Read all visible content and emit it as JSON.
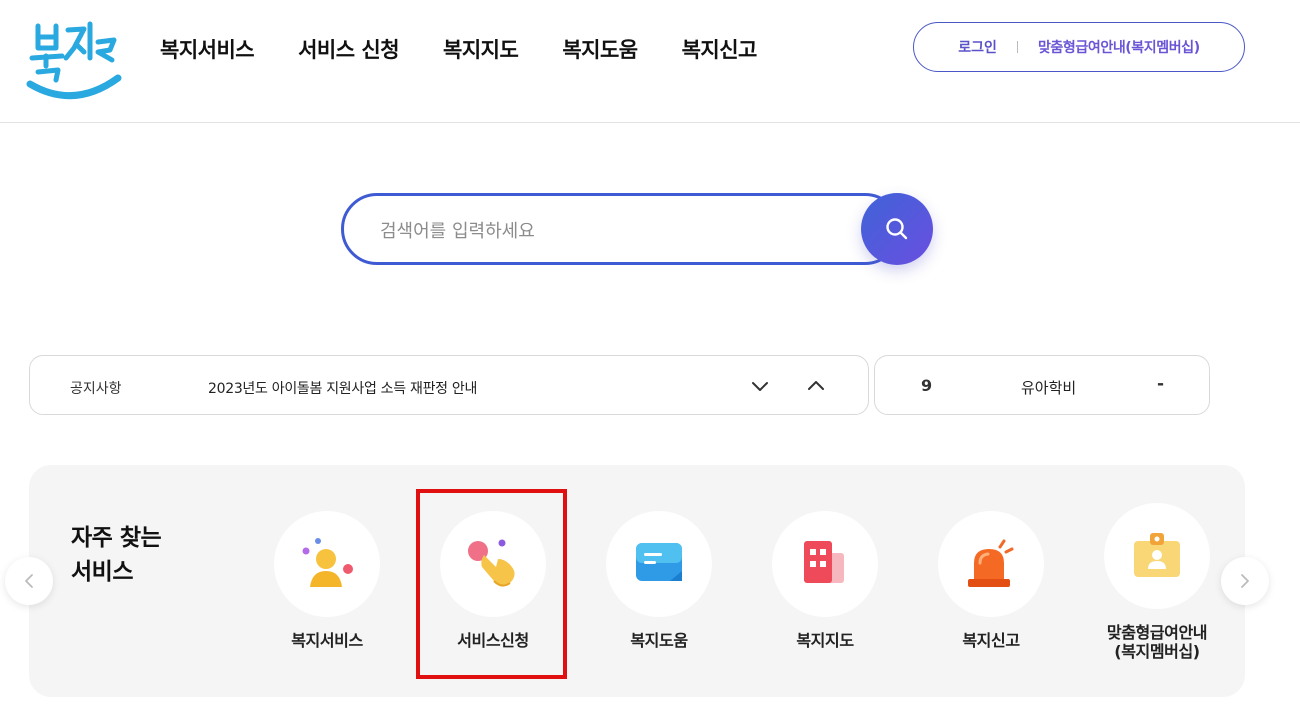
{
  "header": {
    "logo_text": "복지로",
    "nav": [
      "복지서비스",
      "서비스 신청",
      "복지지도",
      "복지도움",
      "복지신고"
    ],
    "login_label": "로그인",
    "custom_label": "맞춤형급여안내(복지멤버십)"
  },
  "search": {
    "placeholder": "검색어를 입력하세요"
  },
  "notice": {
    "label": "공지사항",
    "text": "2023년도 아이돌봄 지원사업 소득 재판정 안내"
  },
  "ranking": {
    "number": "9",
    "keyword": "유아학비",
    "status": "-"
  },
  "quick": {
    "title_line1": "자주 찾는",
    "title_line2": "서비스",
    "items": [
      {
        "label": "복지서비스",
        "icon": "person-icon"
      },
      {
        "label": "서비스신청",
        "icon": "hand-pointer-icon"
      },
      {
        "label": "복지도움",
        "icon": "message-icon"
      },
      {
        "label": "복지지도",
        "icon": "building-icon"
      },
      {
        "label": "복지신고",
        "icon": "siren-icon"
      },
      {
        "label_line1": "맞춤형급여안내",
        "label_line2": "(복지멤버십)",
        "icon": "id-card-icon"
      }
    ]
  },
  "colors": {
    "brand_blue": "#3f5bd3",
    "brand_purple": "#6a4fe0",
    "highlight_red": "#e11010"
  }
}
